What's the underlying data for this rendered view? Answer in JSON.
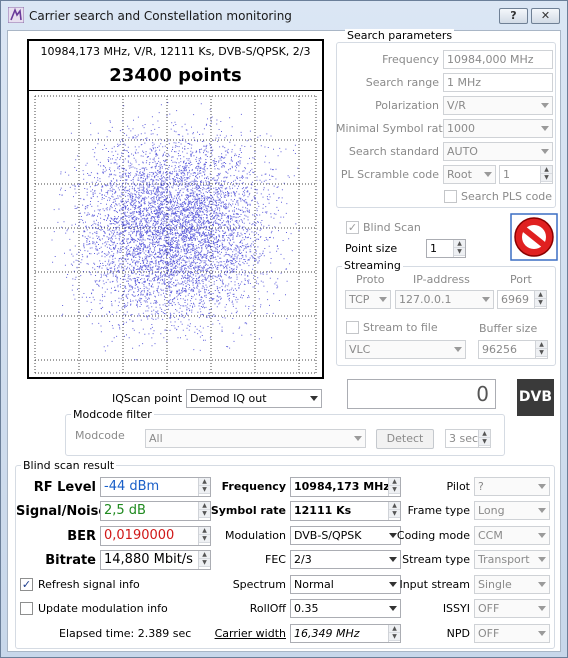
{
  "window": {
    "title": "Carrier search and Constellation monitoring",
    "help_label": "?",
    "close_label": "✕"
  },
  "constellation": {
    "header": "10984,173 MHz, V/R, 12111 Ks, DVB-S/QPSK, 2/3",
    "points_label": "23400 points",
    "dot_color": "#2b2bd0"
  },
  "search": {
    "group_title": "Search parameters",
    "frequency_label": "Frequency",
    "frequency_value": "10984,000 MHz",
    "range_label": "Search range",
    "range_value": "1 MHz",
    "polarization_label": "Polarization",
    "polarization_value": "V/R",
    "min_sr_label": "Minimal Symbol rate",
    "min_sr_value": "1000",
    "standard_label": "Search standard",
    "standard_value": "AUTO",
    "pls_label": "PL Scramble code",
    "pls_mode": "Root",
    "pls_value": "1",
    "search_pls_label": "Search PLS code"
  },
  "blind": {
    "label": "Blind Scan",
    "checked": "✓"
  },
  "point_size": {
    "label": "Point size",
    "value": "1"
  },
  "streaming": {
    "group_title": "Streaming",
    "proto_label": "Proto",
    "ip_label": "IP-address",
    "port_label": "Port",
    "proto_value": "TCP",
    "ip_value": "127.0.0.1",
    "port_value": "6969",
    "to_file_label": "Stream to file",
    "buffer_label": "Buffer size",
    "player_value": "VLC",
    "buffer_value": "96256"
  },
  "iq": {
    "label": "IQScan point",
    "value": "Demod IQ out"
  },
  "counter_value": "0",
  "dvb_logo": "DVB",
  "modcode": {
    "group_title": "Modcode filter",
    "label": "Modcode",
    "value": "All",
    "detect_label": "Detect",
    "timeout_value": "3 sec"
  },
  "result": {
    "group_title": "Blind scan result",
    "rf_label": "RF Level",
    "rf_value": "-44 dBm",
    "sn_label": "Signal/Noise",
    "sn_value": "2,5 dB",
    "ber_label": "BER",
    "ber_value": "0,0190000",
    "bitrate_label": "Bitrate",
    "bitrate_value": "14,880 Mbit/s",
    "freq_label": "Frequency",
    "freq_value": "10984,173 MHz",
    "sr_label": "Symbol rate",
    "sr_value": "12111 Ks",
    "mod_label": "Modulation",
    "mod_value": "DVB-S/QPSK",
    "fec_label": "FEC",
    "fec_value": "2/3",
    "spectrum_label": "Spectrum",
    "spectrum_value": "Normal",
    "rolloff_label": "RollOff",
    "rolloff_value": "0.35",
    "carrier_label": "Carrier width",
    "carrier_value": "16,349 MHz",
    "pilot_label": "Pilot",
    "pilot_value": "?",
    "frame_label": "Frame type",
    "frame_value": "Long",
    "coding_label": "Coding mode",
    "coding_value": "CCM",
    "stream_type_label": "Stream type",
    "stream_type_value": "Transport",
    "input_stream_label": "Input stream",
    "input_stream_value": "Single",
    "issyi_label": "ISSYI",
    "issyi_value": "OFF",
    "npd_label": "NPD",
    "npd_value": "OFF",
    "refresh_label": "Refresh signal info",
    "refresh_checked": "✓",
    "update_label": "Update modulation info",
    "elapsed_label": "Elapsed time: 2.389 sec",
    "colors": {
      "rf": "#1a5fc8",
      "sn": "#1f8a1f",
      "ber": "#d01818"
    }
  }
}
